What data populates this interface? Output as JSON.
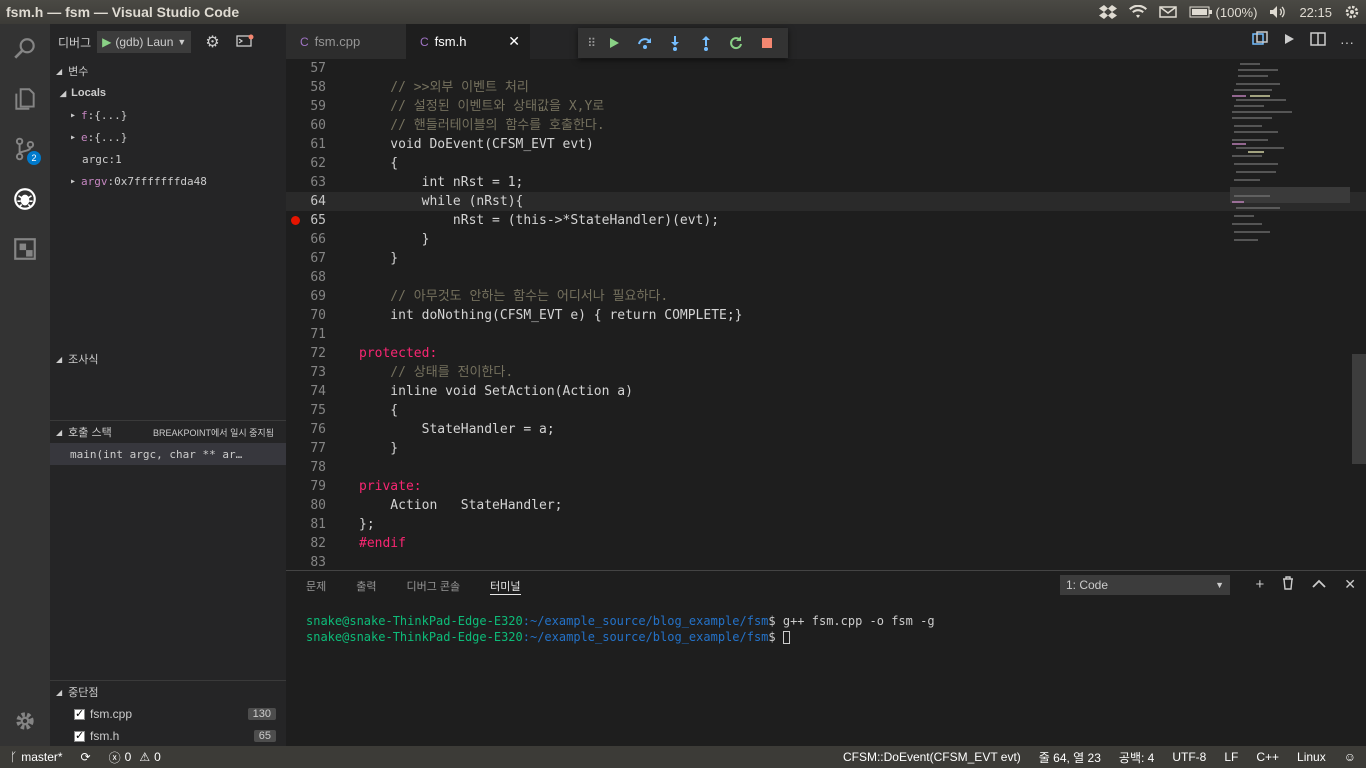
{
  "window": {
    "title": "fsm.h — fsm — Visual Studio Code"
  },
  "tray": {
    "battery": "(100%)",
    "clock": "22:15"
  },
  "activity": {
    "scm_badge": "2"
  },
  "debug": {
    "label": "디버그",
    "config": "(gdb) Laun"
  },
  "sidebar": {
    "variables_title": "변수",
    "locals_title": "Locals",
    "vars": [
      {
        "name": "f",
        "value": "{...}",
        "expandable": true
      },
      {
        "name": "e",
        "value": "{...}",
        "expandable": true
      },
      {
        "name": "argc",
        "value": "1",
        "expandable": false
      },
      {
        "name": "argv",
        "value": "0x7fffffffda48",
        "expandable": true
      }
    ],
    "watch_title": "조사식",
    "callstack_title": "호출 스택",
    "callstack_status": "BREAKPOINT에서 일시 중지됨",
    "callstack_frame": "main(int argc, char ** ar…",
    "breakpoints_title": "중단점",
    "breakpoints": [
      {
        "file": "fsm.cpp",
        "line": "130"
      },
      {
        "file": "fsm.h",
        "line": "65"
      }
    ]
  },
  "tabs": [
    {
      "label": "fsm.cpp"
    },
    {
      "label": "fsm.h"
    }
  ],
  "code": [
    {
      "n": "57",
      "t": ""
    },
    {
      "n": "58",
      "t": "    // >>외부 이벤트 처리"
    },
    {
      "n": "59",
      "t": "    // 설정된 이벤트와 상태값을 X,Y로"
    },
    {
      "n": "60",
      "t": "    // 핸들러테이블의 함수를 호출한다."
    },
    {
      "n": "61",
      "t": "    void DoEvent(CFSM_EVT evt)"
    },
    {
      "n": "62",
      "t": "    {"
    },
    {
      "n": "63",
      "t": "        int nRst = 1;"
    },
    {
      "n": "64",
      "t": "        while (nRst){"
    },
    {
      "n": "65",
      "t": "            nRst = (this->*StateHandler)(evt);"
    },
    {
      "n": "66",
      "t": "        }"
    },
    {
      "n": "67",
      "t": "    }"
    },
    {
      "n": "68",
      "t": ""
    },
    {
      "n": "69",
      "t": "    // 아무것도 안하는 함수는 어디서나 필요하다."
    },
    {
      "n": "70",
      "t": "    int doNothing(CFSM_EVT e) { return COMPLETE;}"
    },
    {
      "n": "71",
      "t": ""
    },
    {
      "n": "72",
      "t": "protected:"
    },
    {
      "n": "73",
      "t": "    // 상태를 전이한다."
    },
    {
      "n": "74",
      "t": "    inline void SetAction(Action a)"
    },
    {
      "n": "75",
      "t": "    {"
    },
    {
      "n": "76",
      "t": "        StateHandler = a;"
    },
    {
      "n": "77",
      "t": "    }"
    },
    {
      "n": "78",
      "t": ""
    },
    {
      "n": "79",
      "t": "private:"
    },
    {
      "n": "80",
      "t": "    Action   StateHandler;"
    },
    {
      "n": "81",
      "t": "};"
    },
    {
      "n": "82",
      "t": "#endif"
    },
    {
      "n": "83",
      "t": ""
    }
  ],
  "panel": {
    "tabs": [
      "문제",
      "출력",
      "디버그 콘솔",
      "터미널"
    ],
    "terminal_select": "1: Code",
    "lines": [
      {
        "user": "snake@snake-ThinkPad-Edge-E320",
        "path": ":~/example_source/blog_example/fsm",
        "cmd": "$ g++ fsm.cpp -o fsm -g"
      },
      {
        "user": "snake@snake-ThinkPad-Edge-E320",
        "path": ":~/example_source/blog_example/fsm",
        "cmd": "$ "
      }
    ]
  },
  "status": {
    "branch": "master*",
    "errors": "0",
    "warnings": "0",
    "context": "CFSM::DoEvent(CFSM_EVT evt)",
    "position": "줄 64, 열 23",
    "spaces": "공백: 4",
    "encoding": "UTF-8",
    "eol": "LF",
    "language": "C++",
    "platform": "Linux"
  }
}
